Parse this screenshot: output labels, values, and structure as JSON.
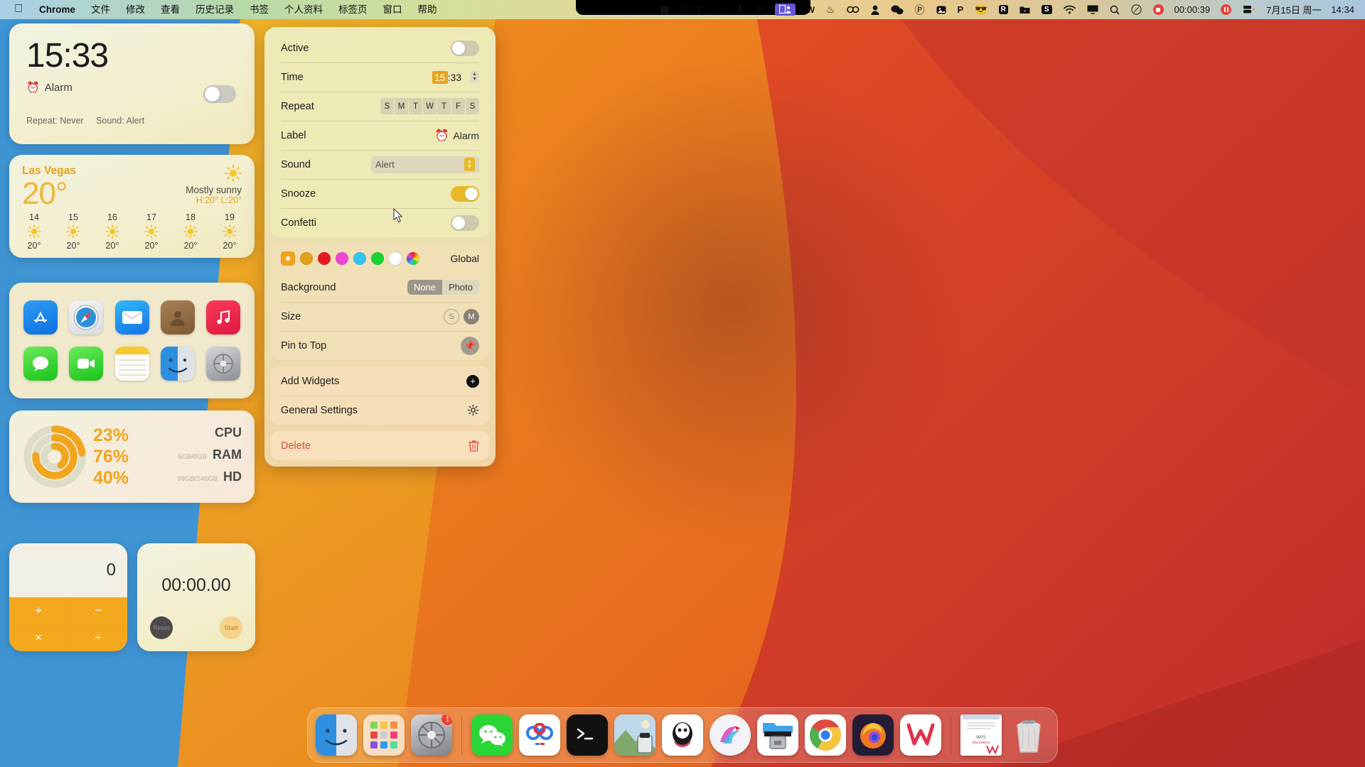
{
  "menubar": {
    "apple_icon": "apple-logo",
    "app_name": "Chrome",
    "items": [
      "文件",
      "修改",
      "查看",
      "历史记录",
      "书签",
      "个人资料",
      "标签页",
      "窗口",
      "帮助"
    ],
    "status_left": [
      {
        "name": "equalizer-icon",
        "glyph": "▮▮"
      },
      {
        "name": "word-count",
        "text": "338字"
      },
      {
        "name": "smiley-icon",
        "glyph": "☺"
      },
      {
        "name": "microphone-icon",
        "glyph": "🎙"
      },
      {
        "name": "input-method-icon",
        "glyph": "中"
      },
      {
        "name": "display-user-icon",
        "glyph": "👤"
      },
      {
        "name": "wps-icon",
        "glyph": "W"
      }
    ],
    "status_right": [
      {
        "name": "tea-icon",
        "glyph": "♨"
      },
      {
        "name": "clover-icon",
        "glyph": "☘"
      },
      {
        "name": "user-icon",
        "glyph": "👤"
      },
      {
        "name": "wechat-icon",
        "glyph": "💬"
      },
      {
        "name": "p-circle-icon",
        "glyph": "Ⓟ"
      },
      {
        "name": "photos-icon",
        "glyph": "🖼"
      },
      {
        "name": "pinyin-icon",
        "glyph": "P"
      },
      {
        "name": "face-icon",
        "glyph": "😎"
      },
      {
        "name": "r-icon",
        "glyph": "R"
      },
      {
        "name": "folder-icon",
        "glyph": "🗂"
      },
      {
        "name": "s-icon",
        "glyph": "S"
      },
      {
        "name": "wifi-icon",
        "glyph": "wifi"
      },
      {
        "name": "screen-mirror-icon",
        "glyph": "🖥"
      },
      {
        "name": "search-icon",
        "glyph": "search"
      },
      {
        "name": "control-center-icon",
        "glyph": "⊘"
      }
    ],
    "recording_time": "00:00:39",
    "date": "7月15日 周一",
    "time": "14:34"
  },
  "alarm_widget": {
    "time": "15:33",
    "label_icon": "alarm-clock-icon",
    "label": "Alarm",
    "repeat_text": "Repeat: Never",
    "sound_text": "Sound: Alert",
    "active": false
  },
  "weather_widget": {
    "city": "Las Vegas",
    "temp": "20°",
    "condition": "Mostly sunny",
    "high_low": "H:20°  L:20°",
    "hours": [
      {
        "label": "14",
        "temp": "20°",
        "icon": "sun-icon"
      },
      {
        "label": "15",
        "temp": "20°",
        "icon": "sun-icon"
      },
      {
        "label": "16",
        "temp": "20°",
        "icon": "sun-icon"
      },
      {
        "label": "17",
        "temp": "20°",
        "icon": "sun-icon"
      },
      {
        "label": "18",
        "temp": "20°",
        "icon": "sun-icon"
      },
      {
        "label": "19",
        "temp": "20°",
        "icon": "sun-icon"
      }
    ]
  },
  "apps_widget": {
    "row1": [
      {
        "name": "app-store-icon",
        "glyph": "A"
      },
      {
        "name": "safari-icon",
        "glyph": "🧭"
      },
      {
        "name": "mail-icon",
        "glyph": "✉"
      },
      {
        "name": "contacts-icon",
        "glyph": "👤"
      },
      {
        "name": "music-icon",
        "glyph": "♪"
      }
    ],
    "row2": [
      {
        "name": "messages-icon",
        "glyph": "💬"
      },
      {
        "name": "facetime-icon",
        "glyph": "📹"
      },
      {
        "name": "notes-icon",
        "glyph": "📝"
      },
      {
        "name": "finder-icon",
        "glyph": "🙂"
      },
      {
        "name": "system-settings-icon",
        "glyph": "⚙"
      }
    ]
  },
  "system_widget": {
    "cpu": {
      "pct": "23%",
      "name": "CPU",
      "sub": ""
    },
    "ram": {
      "pct": "76%",
      "name": "RAM",
      "sub": "6GB/8GB"
    },
    "hd": {
      "pct": "40%",
      "name": "HD",
      "sub": "99GB/246GB"
    }
  },
  "calculator_widget": {
    "display": "0",
    "buttons": [
      "+",
      "−",
      "×",
      "÷"
    ]
  },
  "stopwatch_widget": {
    "time": "00:00.00",
    "reset_label": "Reset",
    "start_label": "Start"
  },
  "panel": {
    "active": {
      "label": "Active",
      "value": false
    },
    "time": {
      "label": "Time",
      "hours": "15",
      "sep": ":",
      "minutes": "33"
    },
    "repeat": {
      "label": "Repeat",
      "days": [
        "S",
        "M",
        "T",
        "W",
        "T",
        "F",
        "S"
      ]
    },
    "label_row": {
      "label": "Label",
      "icon": "alarm-clock-icon",
      "value": "Alarm"
    },
    "sound": {
      "label": "Sound",
      "value": "Alert"
    },
    "snooze": {
      "label": "Snooze",
      "value": true
    },
    "confetti": {
      "label": "Confetti",
      "value": false
    },
    "colors": {
      "swatches": [
        "#f2a31c",
        "#e0a018",
        "#e51b24",
        "#ee44d8",
        "#33c3ef",
        "#17d335",
        "#ffffff",
        "rainbow"
      ],
      "selected_index": 0,
      "scope_label": "Global"
    },
    "background": {
      "label": "Background",
      "options": [
        "None",
        "Photo"
      ],
      "selected": "None"
    },
    "size": {
      "label": "Size",
      "options": [
        "S",
        "M"
      ],
      "selected": "M"
    },
    "pin": {
      "label": "Pin to Top",
      "icon": "pin-icon"
    },
    "add_widgets": {
      "label": "Add Widgets",
      "icon": "plus-circle-icon"
    },
    "general_settings": {
      "label": "General Settings",
      "icon": "gear-icon"
    },
    "delete": {
      "label": "Delete",
      "icon": "trash-icon"
    }
  },
  "dock": {
    "items": [
      {
        "name": "finder-icon",
        "label": "Finder",
        "running": true,
        "badge": ""
      },
      {
        "name": "launchpad-icon",
        "label": "Launchpad",
        "running": false,
        "badge": ""
      },
      {
        "name": "system-settings-icon",
        "label": "System Settings",
        "running": false,
        "badge": "1"
      },
      {
        "name": "wechat-icon",
        "label": "WeChat",
        "running": true,
        "badge": ""
      },
      {
        "name": "baidu-netdisk-icon",
        "label": "Baidu Netdisk",
        "running": true,
        "badge": ""
      },
      {
        "name": "terminal-icon",
        "label": "Terminal",
        "running": true,
        "badge": ""
      },
      {
        "name": "preview-icon",
        "label": "Preview",
        "running": true,
        "badge": ""
      },
      {
        "name": "qq-icon",
        "label": "QQ",
        "running": true,
        "badge": ""
      },
      {
        "name": "bilibili-icon",
        "label": "Bilibili",
        "running": true,
        "badge": ""
      },
      {
        "name": "archive-utility-icon",
        "label": "Archive Utility",
        "running": true,
        "badge": ""
      },
      {
        "name": "chrome-icon",
        "label": "Google Chrome",
        "running": true,
        "badge": ""
      },
      {
        "name": "firefox-icon",
        "label": "Firefox",
        "running": true,
        "badge": ""
      },
      {
        "name": "wps-office-icon",
        "label": "WPS Office",
        "running": true,
        "badge": ""
      }
    ],
    "right_items": [
      {
        "name": "document-icon",
        "label": "Document"
      },
      {
        "name": "trash-icon",
        "label": "Trash"
      }
    ]
  }
}
